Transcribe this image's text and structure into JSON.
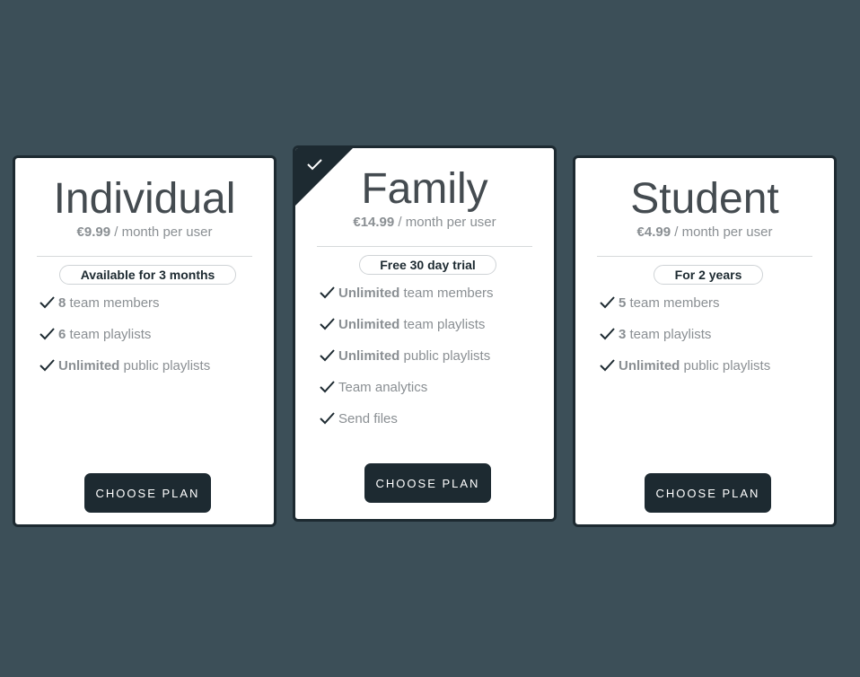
{
  "colors": {
    "background": "#3c4f58",
    "card_border": "#1d2a31",
    "button": "#1d2a31",
    "muted_text": "#8a8f93"
  },
  "plans": [
    {
      "name": "Individual",
      "price": "€9.99",
      "price_suffix": " / month per user",
      "badge": "Available for 3 months",
      "features": [
        {
          "highlight": "8",
          "text": " team members"
        },
        {
          "highlight": "6",
          "text": " team playlists"
        },
        {
          "highlight": "Unlimited",
          "text": " public playlists"
        }
      ],
      "button": "CHOOSE PLAN"
    },
    {
      "name": "Family",
      "selected": true,
      "selected_icon": "check-icon",
      "price": "€14.99",
      "price_suffix": " / month per user",
      "badge": "Free 30 day trial",
      "features": [
        {
          "highlight": "Unlimited",
          "text": " team members"
        },
        {
          "highlight": "Unlimited",
          "text": " team playlists"
        },
        {
          "highlight": "Unlimited",
          "text": " public playlists"
        },
        {
          "highlight": "",
          "text": "Team analytics"
        },
        {
          "highlight": "",
          "text": "Send files"
        }
      ],
      "button": "CHOOSE PLAN"
    },
    {
      "name": "Student",
      "price": "€4.99",
      "price_suffix": " / month per user",
      "badge": "For 2 years",
      "features": [
        {
          "highlight": "5",
          "text": " team members"
        },
        {
          "highlight": "3",
          "text": " team playlists"
        },
        {
          "highlight": "Unlimited",
          "text": " public playlists"
        }
      ],
      "button": "CHOOSE PLAN"
    }
  ]
}
